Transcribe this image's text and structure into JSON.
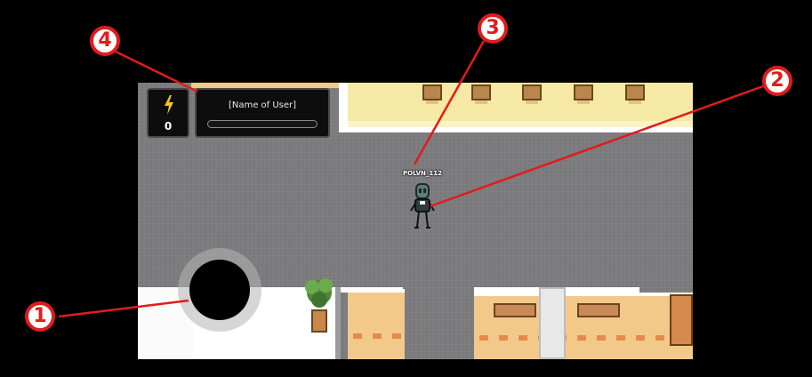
{
  "hud": {
    "energy_icon": "lightning-bolt-icon",
    "energy_value": "0",
    "user_name": "[Name of User]",
    "progress_fraction": 0
  },
  "player": {
    "name": "POLVN_112"
  },
  "annotations": [
    {
      "number": "1",
      "target": "joystick"
    },
    {
      "number": "2",
      "target": "player-character"
    },
    {
      "number": "3",
      "target": "player-name"
    },
    {
      "number": "4",
      "target": "user-hud"
    }
  ],
  "colors": {
    "annotation_red": "#e21b1b",
    "floor": "#7c7c7f",
    "room_yellow": "#f6e9a6",
    "counter": "#f3c98a",
    "energy_bolt": "#f5c518"
  }
}
